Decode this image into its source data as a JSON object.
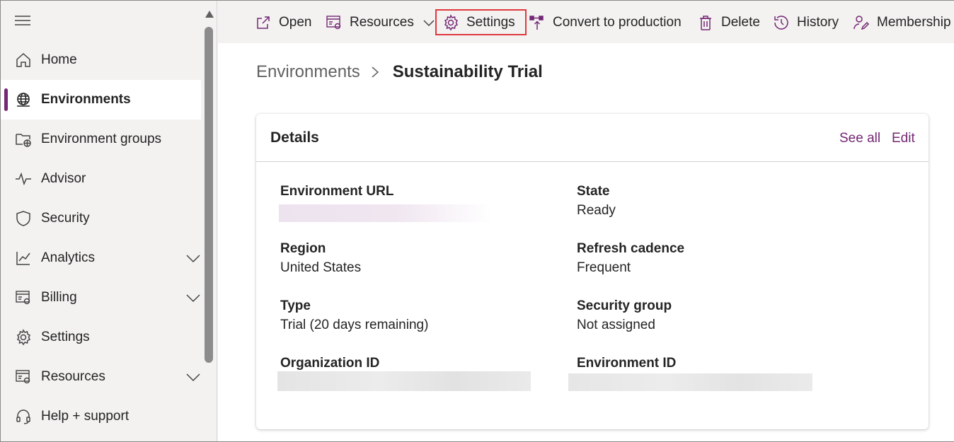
{
  "sidebar": {
    "items": [
      {
        "label": "Home",
        "icon": "home-icon"
      },
      {
        "label": "Environments",
        "icon": "globe-icon",
        "active": true
      },
      {
        "label": "Environment groups",
        "icon": "folder-globe-icon"
      },
      {
        "label": "Advisor",
        "icon": "pulse-icon"
      },
      {
        "label": "Security",
        "icon": "shield-icon"
      },
      {
        "label": "Analytics",
        "icon": "chart-icon",
        "expandable": true
      },
      {
        "label": "Billing",
        "icon": "billing-icon",
        "expandable": true
      },
      {
        "label": "Settings",
        "icon": "gear-icon"
      },
      {
        "label": "Resources",
        "icon": "resources-icon",
        "expandable": true
      },
      {
        "label": "Help + support",
        "icon": "headset-icon"
      }
    ]
  },
  "toolbar": {
    "open": "Open",
    "resources": "Resources",
    "settings": "Settings",
    "convert": "Convert to production",
    "delete": "Delete",
    "history": "History",
    "membership": "Membership"
  },
  "breadcrumb": {
    "parent": "Environments",
    "current": "Sustainability Trial"
  },
  "details": {
    "title": "Details",
    "see_all": "See all",
    "edit": "Edit",
    "fields": {
      "env_url_label": "Environment URL",
      "state_label": "State",
      "state_value": "Ready",
      "region_label": "Region",
      "region_value": "United States",
      "refresh_label": "Refresh cadence",
      "refresh_value": "Frequent",
      "type_label": "Type",
      "type_value": "Trial (20 days remaining)",
      "security_group_label": "Security group",
      "security_group_value": "Not assigned",
      "org_id_label": "Organization ID",
      "env_id_label": "Environment ID"
    }
  },
  "colors": {
    "accent": "#742774",
    "highlight_box": "#e0383e"
  }
}
